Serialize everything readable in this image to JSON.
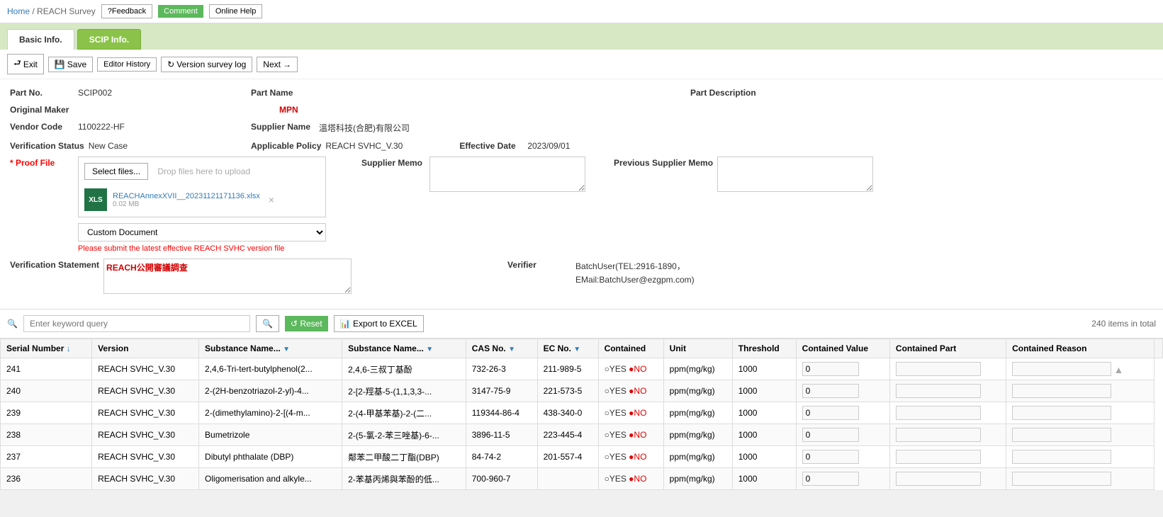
{
  "breadcrumb": {
    "home": "Home",
    "separator": "/",
    "current": "REACH Survey"
  },
  "top_buttons": {
    "feedback": "?Feedback",
    "comment": "Comment",
    "online_help": "Online Help"
  },
  "tabs": [
    {
      "label": "Basic Info.",
      "active": true
    },
    {
      "label": "SCIP Info.",
      "active": false
    }
  ],
  "toolbar": {
    "exit": "Exit",
    "save": "Save",
    "editor_history": "Editor History",
    "version_survey_log": "Version survey log",
    "next": "Next"
  },
  "form": {
    "part_no_label": "Part No.",
    "part_no_value": "SCIP002",
    "part_name_label": "Part Name",
    "part_name_value": "",
    "part_description_label": "Part Description",
    "part_description_value": "",
    "original_maker_label": "Original Maker",
    "original_maker_value": "",
    "mpn_label": "MPN",
    "mpn_value": "",
    "vendor_code_label": "Vendor Code",
    "vendor_code_value": "1100222-HF",
    "supplier_name_label": "Supplier Name",
    "supplier_name_value": "溫塔科技(合肥)有限公司",
    "verification_status_label": "Verification Status",
    "verification_status_value": "New Case",
    "applicable_policy_label": "Applicable Policy",
    "applicable_policy_value": "REACH SVHC_V.30",
    "effective_date_label": "Effective Date",
    "effective_date_value": "2023/09/01",
    "proof_file_label": "* Proof File",
    "select_files_btn": "Select files...",
    "drop_zone_text": "Drop files here to upload",
    "file_name": "REACHAnnexXVII__20231121171136.xlsx",
    "file_size": "0.02 MB",
    "custom_doc_label": "Custom Document",
    "warning_message": "Please submit the latest effective REACH SVHC version file",
    "supplier_memo_label": "Supplier Memo",
    "supplier_memo_value": "",
    "prev_supplier_memo_label": "Previous Supplier Memo",
    "prev_supplier_memo_value": "",
    "verification_statement_label": "Verification Statement",
    "verification_statement_value": "REACH公開審議調查",
    "verifier_label": "Verifier",
    "verifier_value": "BatchUser(TEL:2916-1890，EMail:BatchUser@ezgpm.com)"
  },
  "search": {
    "placeholder": "Enter keyword query",
    "reset_btn": "Reset",
    "export_btn": "Export to EXCEL",
    "items_total": "240 items in total"
  },
  "table": {
    "headers": [
      {
        "label": "Serial Number",
        "sortable": true,
        "filter": false
      },
      {
        "label": "Version",
        "sortable": false,
        "filter": false
      },
      {
        "label": "Substance Name...",
        "sortable": false,
        "filter": true
      },
      {
        "label": "Substance Name...",
        "sortable": false,
        "filter": true
      },
      {
        "label": "CAS No.",
        "sortable": false,
        "filter": true
      },
      {
        "label": "EC No.",
        "sortable": false,
        "filter": true
      },
      {
        "label": "Contained",
        "sortable": false,
        "filter": false
      },
      {
        "label": "Unit",
        "sortable": false,
        "filter": false
      },
      {
        "label": "Threshold",
        "sortable": false,
        "filter": false
      },
      {
        "label": "Contained Value",
        "sortable": false,
        "filter": false
      },
      {
        "label": "Contained Part",
        "sortable": false,
        "filter": false
      },
      {
        "label": "Contained Reason",
        "sortable": false,
        "filter": false
      }
    ],
    "rows": [
      {
        "serial": "241",
        "version": "REACH SVHC_V.30",
        "substance_name_en": "2,4,6-Tri-tert-butylphenol(2...",
        "substance_name_cn": "2,4,6-三叔丁基酚",
        "cas_no": "732-26-3",
        "ec_no": "211-989-5",
        "contained": "OYES ●NO",
        "unit": "ppm(mg/kg)",
        "threshold": "1000",
        "contained_value": "0",
        "contained_part": "",
        "contained_reason": ""
      },
      {
        "serial": "240",
        "version": "REACH SVHC_V.30",
        "substance_name_en": "2-(2H-benzotriazol-2-yl)-4...",
        "substance_name_cn": "2-[2-羥基-5-(1,1,3,3-...",
        "cas_no": "3147-75-9",
        "ec_no": "221-573-5",
        "contained": "OYES ●NO",
        "unit": "ppm(mg/kg)",
        "threshold": "1000",
        "contained_value": "0",
        "contained_part": "",
        "contained_reason": ""
      },
      {
        "serial": "239",
        "version": "REACH SVHC_V.30",
        "substance_name_en": "2-(dimethylamino)-2-[(4-m...",
        "substance_name_cn": "2-(4-甲基苯基)-2-(二...",
        "cas_no": "119344-86-4",
        "ec_no": "438-340-0",
        "contained": "OYES ●NO",
        "unit": "ppm(mg/kg)",
        "threshold": "1000",
        "contained_value": "0",
        "contained_part": "",
        "contained_reason": ""
      },
      {
        "serial": "238",
        "version": "REACH SVHC_V.30",
        "substance_name_en": "Bumetrizole",
        "substance_name_cn": "2-(5-氯-2-苯三唑基)-6-...",
        "cas_no": "3896-11-5",
        "ec_no": "223-445-4",
        "contained": "OYES ●NO",
        "unit": "ppm(mg/kg)",
        "threshold": "1000",
        "contained_value": "0",
        "contained_part": "",
        "contained_reason": ""
      },
      {
        "serial": "237",
        "version": "REACH SVHC_V.30",
        "substance_name_en": "Dibutyl phthalate (DBP)",
        "substance_name_cn": "鄰苯二甲酸二丁酯(DBP)",
        "cas_no": "84-74-2",
        "ec_no": "201-557-4",
        "contained": "OYES ●NO",
        "unit": "ppm(mg/kg)",
        "threshold": "1000",
        "contained_value": "0",
        "contained_part": "",
        "contained_reason": ""
      },
      {
        "serial": "236",
        "version": "REACH SVHC_V.30",
        "substance_name_en": "Oligomerisation and alkyle...",
        "substance_name_cn": "2-苯基丙烯與苯酚的低...",
        "cas_no": "700-960-7",
        "ec_no": "",
        "contained": "OYES ●NO",
        "unit": "ppm(mg/kg)",
        "threshold": "1000",
        "contained_value": "0",
        "contained_part": "",
        "contained_reason": ""
      }
    ]
  }
}
